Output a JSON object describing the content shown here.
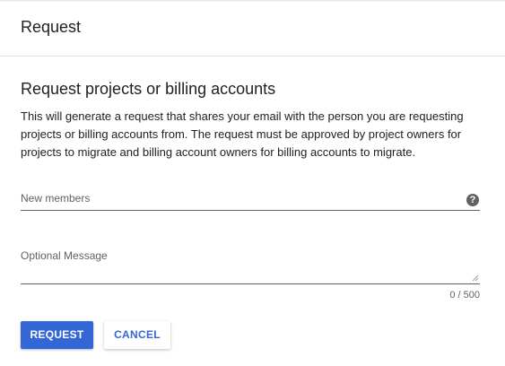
{
  "header": {
    "title": "Request"
  },
  "main": {
    "section_title": "Request projects or billing accounts",
    "description": "This will generate a request that shares your email with the person you are requesting projects or billing accounts from. The request must be approved by project owners for projects to migrate and billing account owners for billing accounts to migrate.",
    "members_field": {
      "label": "New members",
      "value": ""
    },
    "help_icon": "?",
    "message_field": {
      "label": "Optional Message",
      "value": ""
    },
    "counter": "0 / 500"
  },
  "actions": {
    "request_label": "REQUEST",
    "cancel_label": "CANCEL"
  },
  "colors": {
    "accent": "#3367d6",
    "text": "#202124",
    "muted": "#5f6368",
    "divider": "#e0e0e0"
  }
}
